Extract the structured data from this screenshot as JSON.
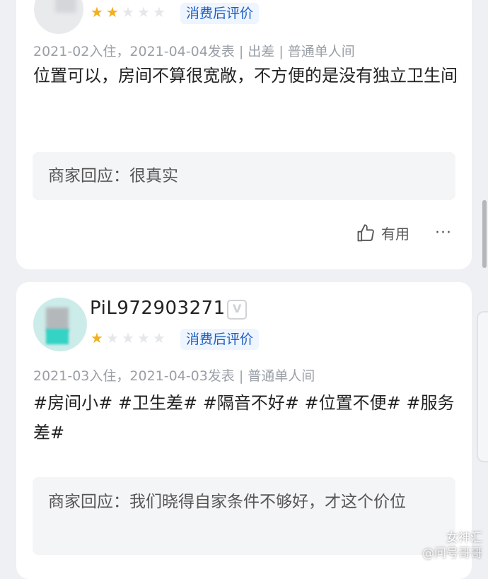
{
  "reviews": [
    {
      "rating": 2,
      "max_rating": 5,
      "badge": "消费后评价",
      "meta": "2021-02入住，2021-04-04发表 | 出差 | 普通单人间",
      "content": "位置可以，房间不算很宽敞，不方便的是没有独立卫生间",
      "reply": "商家回应：很真实",
      "useful_label": "有用",
      "more": "···"
    },
    {
      "username": "PiL972903271",
      "rating": 1,
      "max_rating": 5,
      "badge": "消费后评价",
      "meta": "2021-03入住，2021-04-03发表 | 普通单人间",
      "content": "#房间小# #卫生差# #隔音不好# #位置不便# #服务差#",
      "reply": "商家回应：我们晓得自家条件不够好，才这个价位"
    }
  ],
  "watermark": {
    "line1": "女神汇",
    "line2": "@问号哥哥"
  },
  "colors": {
    "star_on": "#f2b01e",
    "star_off": "#e5e7ea",
    "badge_text": "#1f5fc0",
    "badge_bg": "#eef5ff"
  }
}
